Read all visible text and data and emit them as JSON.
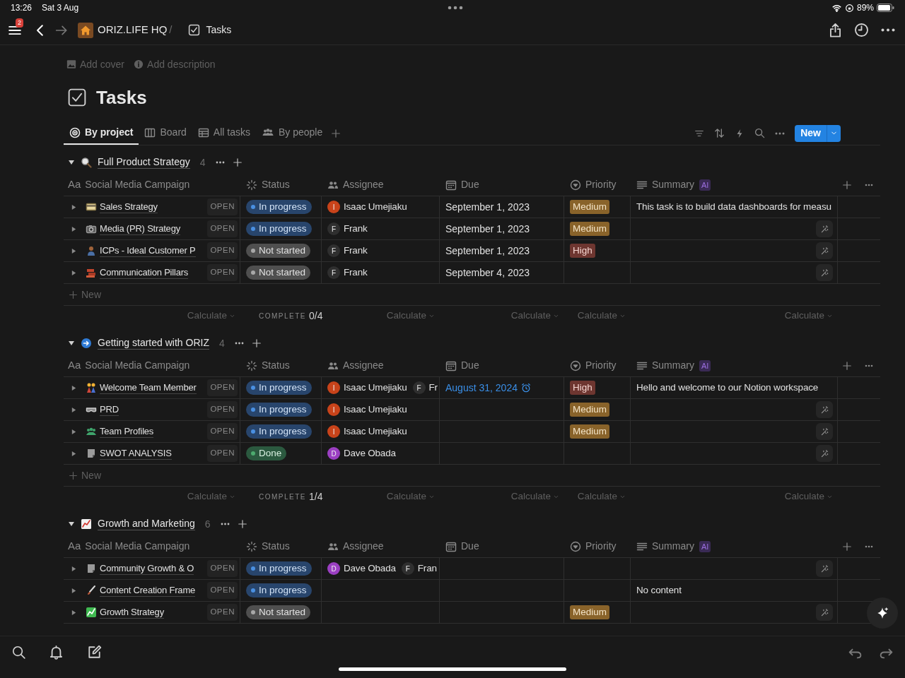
{
  "status_bar": {
    "time": "13:26",
    "date": "Sat 3 Aug",
    "battery": "89%"
  },
  "nav": {
    "notifications": "2",
    "workspace": "ORIZ.LIFE HQ",
    "separator": "/",
    "page": "Tasks"
  },
  "page": {
    "add_cover": "Add cover",
    "add_description": "Add description",
    "title": "Tasks"
  },
  "views": [
    {
      "label": "By project",
      "selected": true
    },
    {
      "label": "Board",
      "selected": false
    },
    {
      "label": "All tasks",
      "selected": false
    },
    {
      "label": "By people",
      "selected": false
    }
  ],
  "new_button": "New",
  "groups": [
    {
      "title": "Full Product Strategy",
      "count": "4",
      "columns": [
        {
          "label": "Social Media Campaign",
          "icon_text": "Aa"
        },
        {
          "label": "Status"
        },
        {
          "label": "Assignee"
        },
        {
          "label": "Due"
        },
        {
          "label": "Priority"
        },
        {
          "label": "Summary",
          "badge": "AI"
        }
      ],
      "rows": [
        {
          "name": "Sales Strategy",
          "open": "OPEN",
          "status": {
            "label": "In progress",
            "kind": "in_progress"
          },
          "assignees": [
            {
              "initial": "I",
              "name": "Isaac Umejiaku",
              "color": "#c8431a"
            }
          ],
          "due": {
            "text": "September 1, 2023",
            "reminder": false
          },
          "priority": {
            "label": "Medium",
            "kind": "medium"
          },
          "summary": "This task is to build data dashboards for measu",
          "ai_fill": false
        },
        {
          "name": "Media (PR) Strategy",
          "open": "OPEN",
          "status": {
            "label": "In progress",
            "kind": "in_progress"
          },
          "assignees": [
            {
              "initial": "F",
              "name": "Frank",
              "color": "#2f2f2f"
            }
          ],
          "due": {
            "text": "September 1, 2023",
            "reminder": false
          },
          "priority": {
            "label": "Medium",
            "kind": "medium"
          },
          "ai_fill": true
        },
        {
          "name": "ICPs - Ideal Customer P",
          "open": "OPEN",
          "status": {
            "label": "Not started",
            "kind": "not_started"
          },
          "assignees": [
            {
              "initial": "F",
              "name": "Frank",
              "color": "#2f2f2f"
            }
          ],
          "due": {
            "text": "September 1, 2023",
            "reminder": false
          },
          "priority": {
            "label": "High",
            "kind": "high"
          },
          "ai_fill": true
        },
        {
          "name": "Communication Pillars",
          "open": "OPEN",
          "status": {
            "label": "Not started",
            "kind": "not_started"
          },
          "assignees": [
            {
              "initial": "F",
              "name": "Frank",
              "color": "#2f2f2f"
            }
          ],
          "due": {
            "text": "September 4, 2023",
            "reminder": false
          },
          "ai_fill": true
        }
      ],
      "new_row": "New",
      "footer": [
        {
          "kind": "calculate",
          "label": "Calculate"
        },
        {
          "kind": "complete",
          "label": "COMPLETE",
          "value": "0/4"
        },
        {
          "kind": "calculate",
          "label": "Calculate"
        },
        {
          "kind": "calculate",
          "label": "Calculate"
        },
        {
          "kind": "calculate",
          "label": "Calculate"
        },
        {
          "kind": "calculate",
          "label": "Calculate"
        }
      ]
    },
    {
      "title": "Getting started with ORIZ",
      "count": "4",
      "columns": [
        {
          "label": "Social Media Campaign",
          "icon_text": "Aa"
        },
        {
          "label": "Status"
        },
        {
          "label": "Assignee"
        },
        {
          "label": "Due"
        },
        {
          "label": "Priority"
        },
        {
          "label": "Summary",
          "badge": "AI"
        }
      ],
      "rows": [
        {
          "name": "Welcome Team Member",
          "open": "OPEN",
          "status": {
            "label": "In progress",
            "kind": "in_progress"
          },
          "assignees": [
            {
              "initial": "I",
              "name": "Isaac Umejiaku",
              "color": "#c8431a"
            },
            {
              "initial": "F",
              "name": "Fr",
              "color": "#2f2f2f"
            }
          ],
          "due": {
            "text": "August 31, 2024",
            "reminder": true
          },
          "priority": {
            "label": "High",
            "kind": "high"
          },
          "summary": "Hello and welcome to our Notion workspace",
          "ai_fill": false
        },
        {
          "name": "PRD",
          "open": "OPEN",
          "status": {
            "label": "In progress",
            "kind": "in_progress"
          },
          "assignees": [
            {
              "initial": "I",
              "name": "Isaac Umejiaku",
              "color": "#c8431a"
            }
          ],
          "priority": {
            "label": "Medium",
            "kind": "medium"
          },
          "ai_fill": true
        },
        {
          "name": "Team Profiles",
          "open": "OPEN",
          "status": {
            "label": "In progress",
            "kind": "in_progress"
          },
          "assignees": [
            {
              "initial": "I",
              "name": "Isaac Umejiaku",
              "color": "#c8431a"
            }
          ],
          "priority": {
            "label": "Medium",
            "kind": "medium"
          },
          "ai_fill": true
        },
        {
          "name": "SWOT ANALYSIS",
          "open": "OPEN",
          "status": {
            "label": "Done",
            "kind": "done"
          },
          "assignees": [
            {
              "initial": "D",
              "name": "Dave Obada",
              "color": "#9b3fc2"
            }
          ],
          "ai_fill": true
        }
      ],
      "new_row": "New",
      "footer": [
        {
          "kind": "calculate",
          "label": "Calculate"
        },
        {
          "kind": "complete",
          "label": "COMPLETE",
          "value": "1/4"
        },
        {
          "kind": "calculate",
          "label": "Calculate"
        },
        {
          "kind": "calculate",
          "label": "Calculate"
        },
        {
          "kind": "calculate",
          "label": "Calculate"
        },
        {
          "kind": "calculate",
          "label": "Calculate"
        }
      ]
    },
    {
      "title": "Growth and Marketing",
      "count": "6",
      "columns": [
        {
          "label": "Social Media Campaign",
          "icon_text": "Aa"
        },
        {
          "label": "Status"
        },
        {
          "label": "Assignee"
        },
        {
          "label": "Due"
        },
        {
          "label": "Priority"
        },
        {
          "label": "Summary",
          "badge": "AI"
        }
      ],
      "rows": [
        {
          "name": "Community Growth & O",
          "open": "OPEN",
          "status": {
            "label": "In progress",
            "kind": "in_progress"
          },
          "assignees": [
            {
              "initial": "D",
              "name": "Dave Obada",
              "color": "#9b3fc2"
            },
            {
              "initial": "F",
              "name": "Fran",
              "color": "#2f2f2f"
            }
          ],
          "ai_fill": true
        },
        {
          "name": "Content Creation Frame",
          "open": "OPEN",
          "status": {
            "label": "In progress",
            "kind": "in_progress"
          },
          "summary": "No content",
          "ai_fill": false
        },
        {
          "name": "Growth Strategy",
          "open": "OPEN",
          "status": {
            "label": "Not started",
            "kind": "not_started"
          },
          "priority": {
            "label": "Medium",
            "kind": "medium"
          },
          "ai_fill": true
        }
      ]
    }
  ]
}
